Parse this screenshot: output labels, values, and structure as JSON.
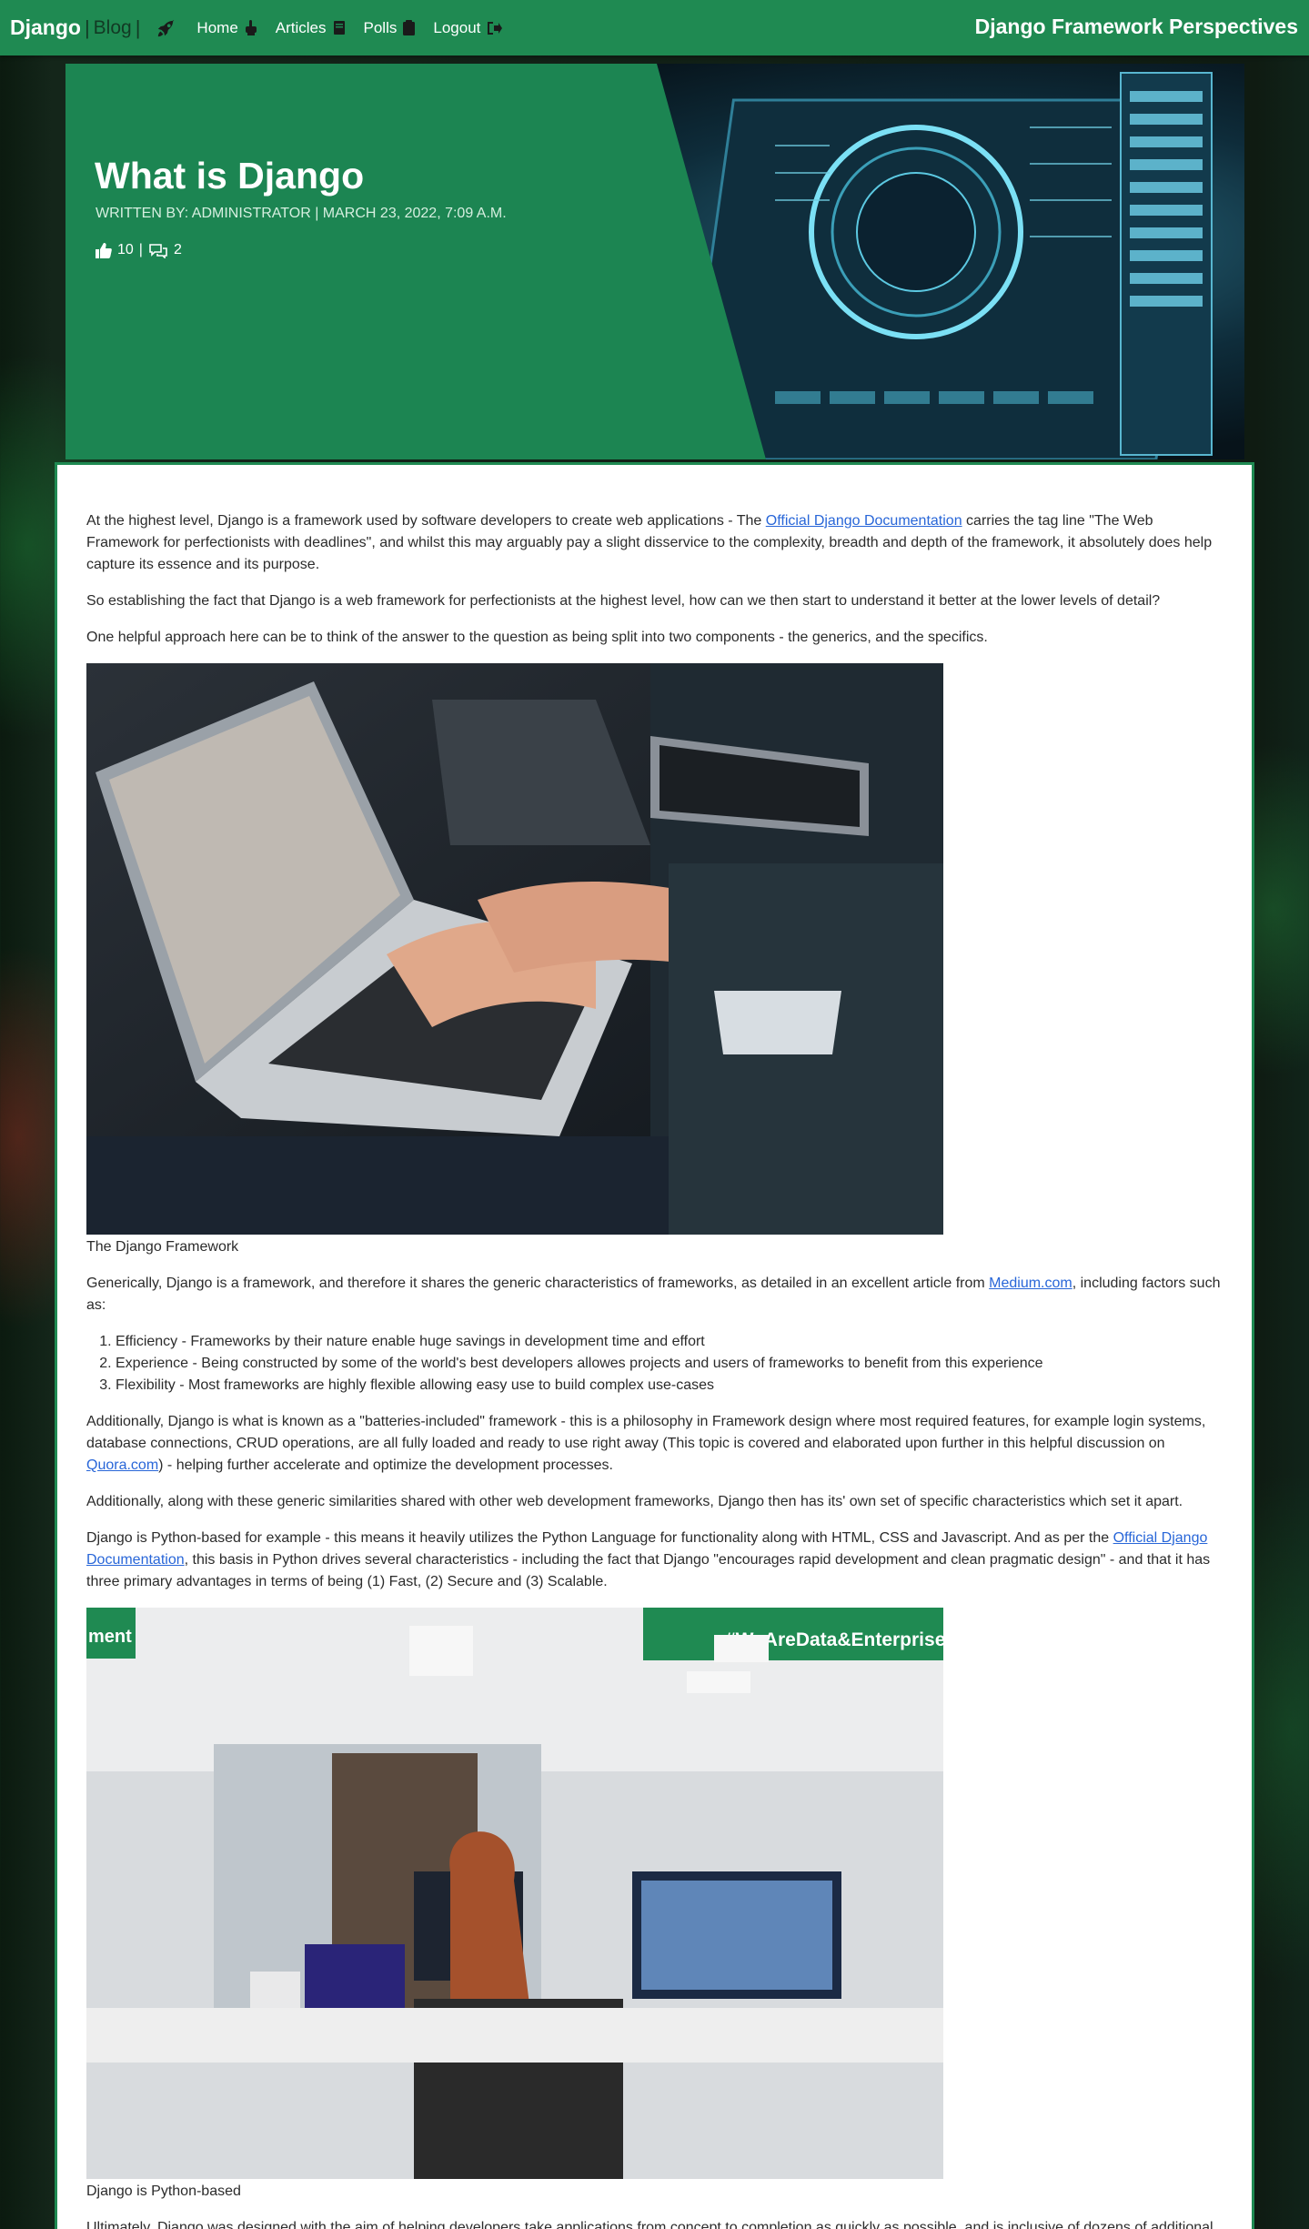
{
  "navbar": {
    "brand": "Django",
    "separator": "|",
    "blog": "Blog",
    "links": [
      {
        "label": "Home",
        "icon": "hand-point-down-icon"
      },
      {
        "label": "Articles",
        "icon": "book-icon"
      },
      {
        "label": "Polls",
        "icon": "clipboard-icon"
      },
      {
        "label": "Logout",
        "icon": "logout-icon"
      }
    ],
    "site_title": "Django Framework Perspectives"
  },
  "hero": {
    "title": "What is Django",
    "meta": "WRITTEN BY: ADMINISTRATOR | MARCH 23, 2022, 7:09 A.M.",
    "likes": "10",
    "stats_separator": "|",
    "comments": "2"
  },
  "article": {
    "p1": {
      "before": "At the highest level, Django is a framework used by software developers to create web applications - The ",
      "link": "Official Django Documentation",
      "after": " carries the tag line \"The Web Framework for perfectionists with deadlines\", and whilst this may arguably pay a slight disservice to the complexity, breadth and depth of the framework, it absolutely does help capture its essence and its purpose."
    },
    "p2": "So establishing the fact that Django is a web framework for perfectionists at the highest level, how can we then start to understand it better at the lower levels of detail?",
    "p3": "One helpful approach here can be to think of the answer to the question as being split into two components - the generics, and the specifics.",
    "caption1": "The Django Framework",
    "p4": {
      "before": "Generically, Django is a framework, and therefore it shares the generic characteristics of frameworks, as detailed in an excellent article from ",
      "link": "Medium.com",
      "after": ", including factors such as:"
    },
    "list": [
      "Efficiency - Frameworks by their nature enable huge savings in development time and effort",
      "Experience - Being constructed by some of the world's best developers allowes projects and  users of frameworks to benefit from this experience",
      "Flexibility - Most frameworks are highly flexible allowing easy use to build complex use-cases"
    ],
    "p5": {
      "before": "Additionally, Django is what is known as a \"batteries-included\" framework - this is a philosophy in Framework design where most required features, for example login systems, database connections, CRUD operations, are all fully loaded and ready to use right away (This topic is covered and elaborated upon further in this helpful discussion on ",
      "link": "Quora.com",
      "after": ") - helping further accelerate and optimize the development processes."
    },
    "p6": "Additionally, along with these generic similarities shared with other web development frameworks, Django then has its' own set of specific characteristics which set it apart.",
    "p7": {
      "before": "Django is Python-based for example - this means it heavily utilizes the Python Language for functionality along with HTML, CSS and Javascript. And as per the ",
      "link": "Official Django Documentation",
      "after": ", this basis in Python drives several characteristics - including the fact that Django \"encourages rapid development and clean pragmatic design\" - and that it has three primary advantages in terms of being (1) Fast, (2) Secure and (3) Scalable."
    },
    "image2_sign_text": "#WeAreData&Enterprise",
    "image2_sign_left": "ment",
    "caption2": "Django is Python-based",
    "p8": "Ultimately, Django was designed with the aim of helping developers take applications from concept to completion as quickly as possible, and is inclusive of dozens of additional"
  }
}
